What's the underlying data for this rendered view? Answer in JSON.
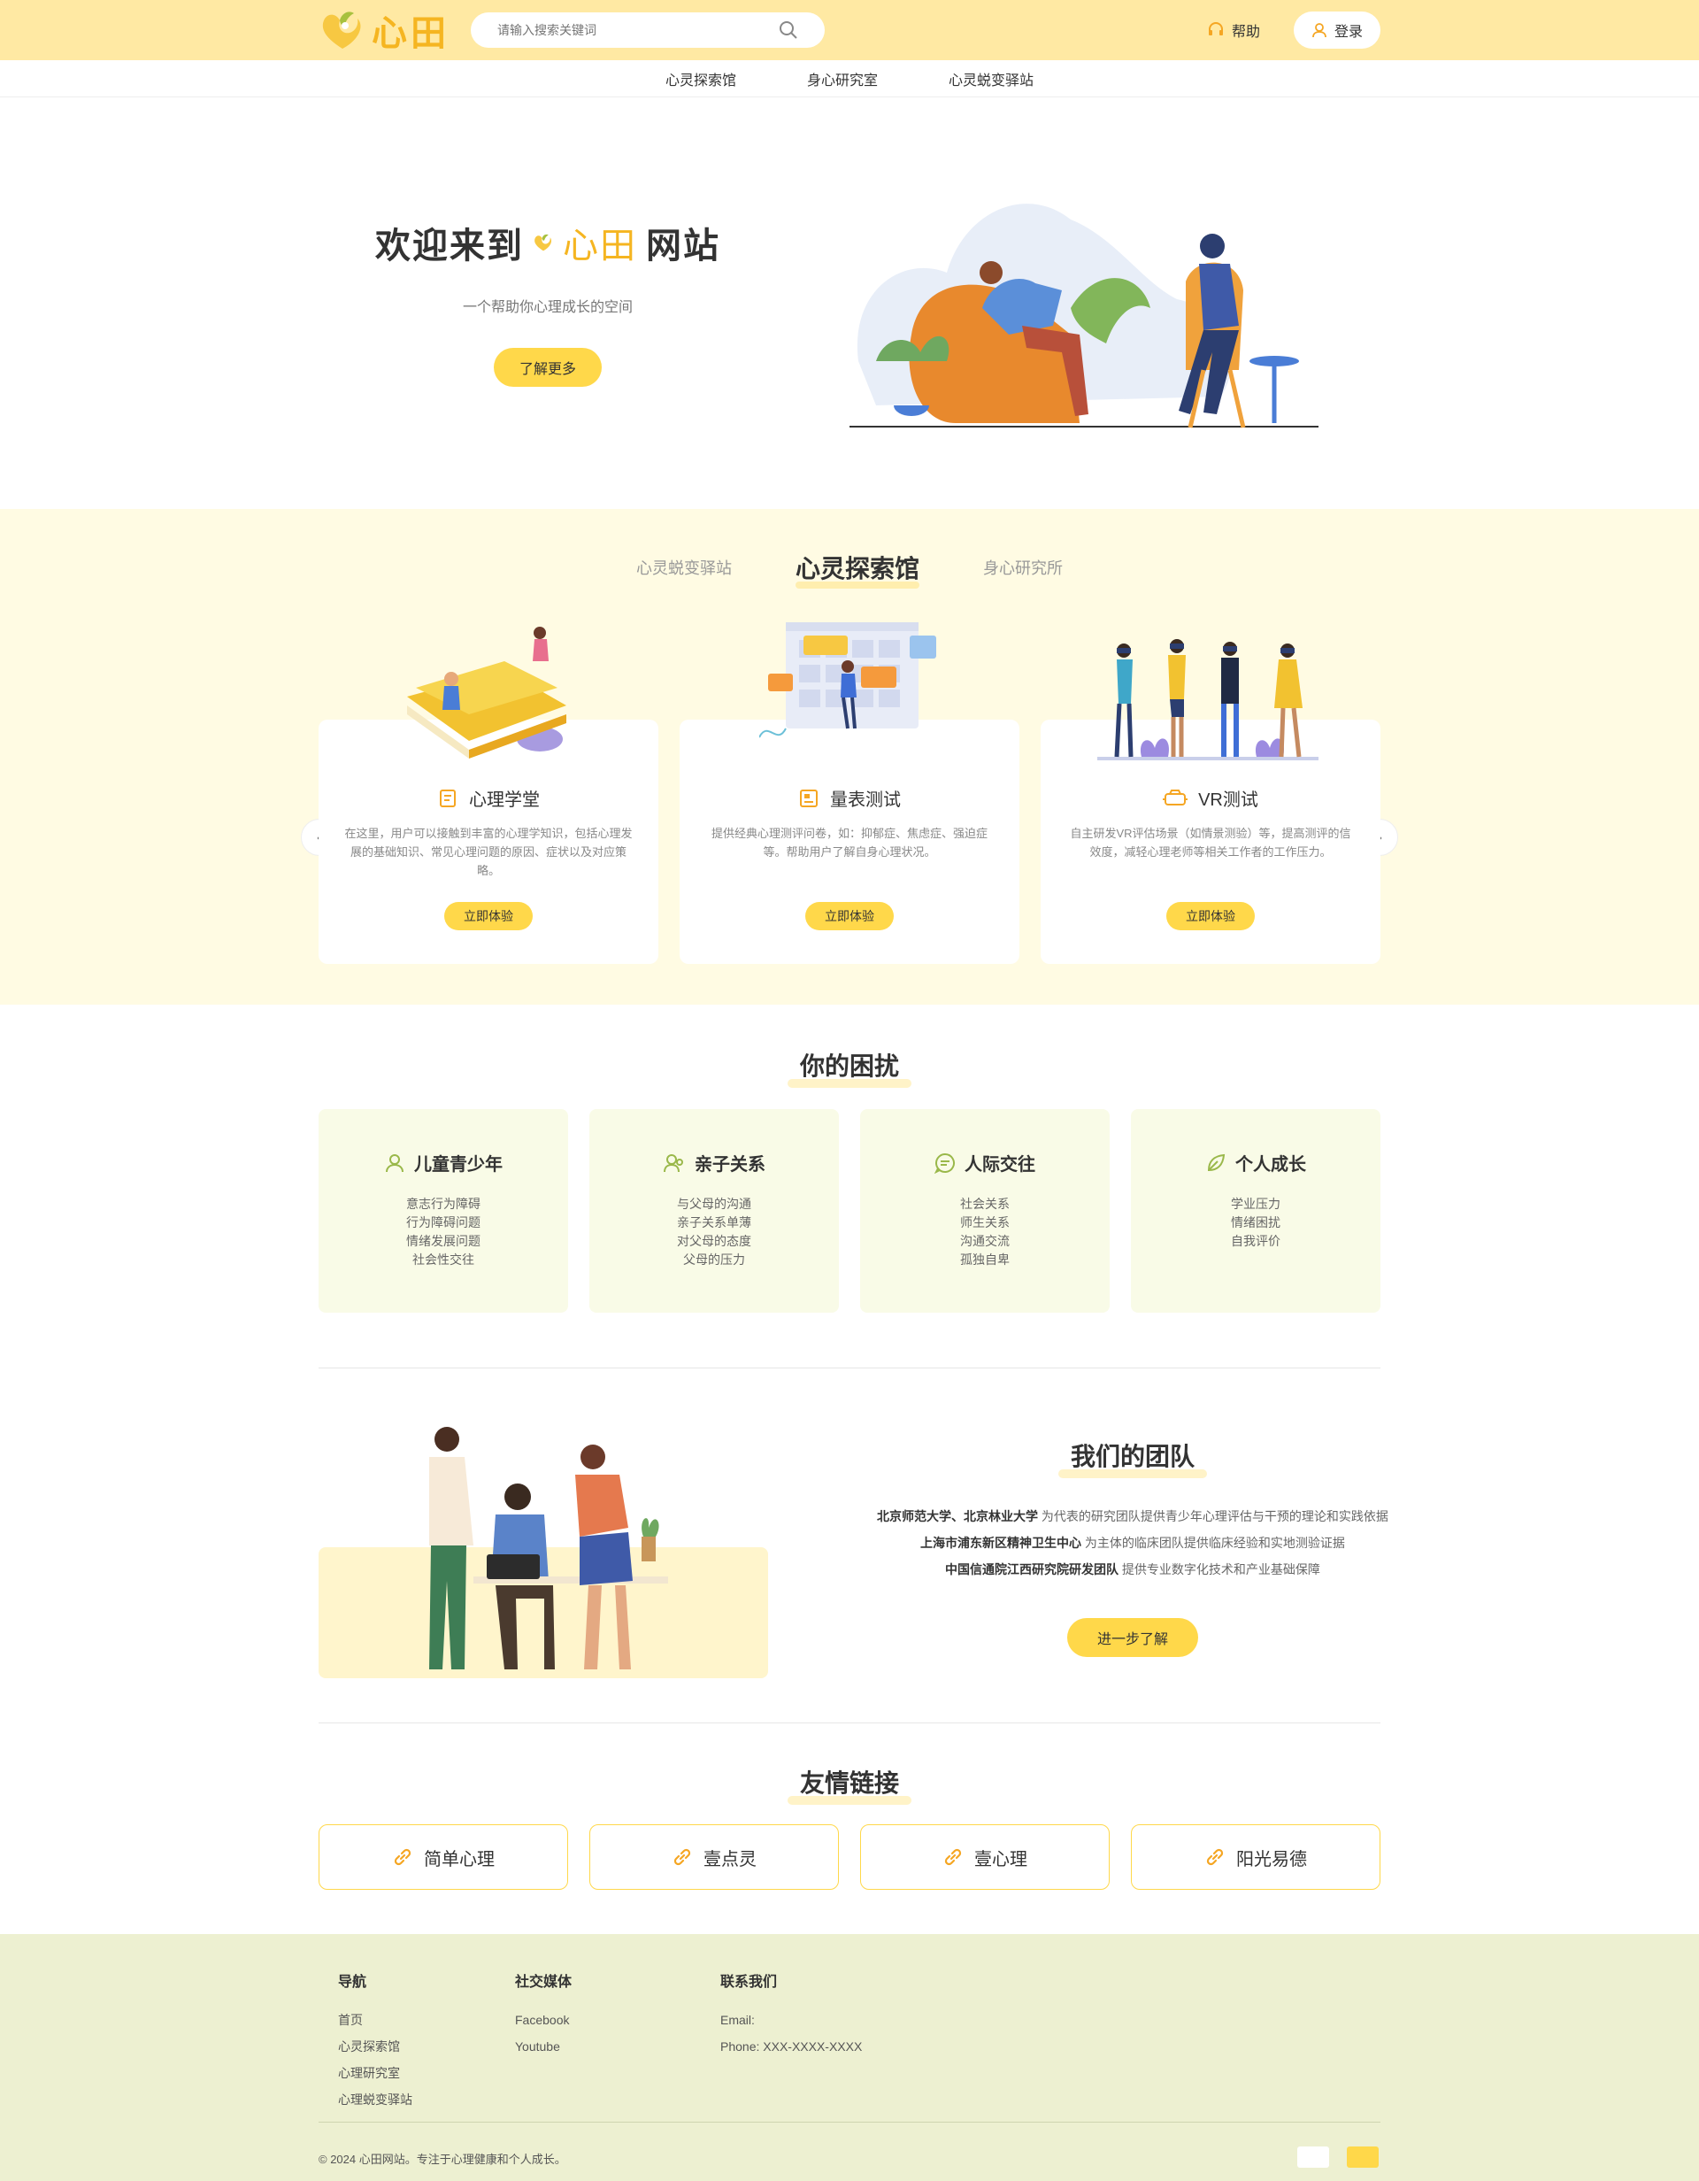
{
  "header": {
    "logo_text": "心田",
    "search_placeholder": "请输入搜索关键词",
    "help_label": "帮助",
    "login_label": "登录"
  },
  "nav": [
    "心灵探索馆",
    "身心研究室",
    "心灵蜕变驿站"
  ],
  "hero": {
    "title_before": "欢迎来到",
    "title_brand": "心田",
    "title_after": "网站",
    "subtitle": "一个帮助你心理成长的空间",
    "button": "了解更多"
  },
  "explore": {
    "tabs": [
      "心灵蜕变驿站",
      "心灵探索馆",
      "身心研究所"
    ],
    "active_tab": 1,
    "cards": [
      {
        "title": "心理学堂",
        "icon": "book-icon",
        "desc": "在这里，用户可以接触到丰富的心理学知识，包括心理发展的基础知识、常见心理问题的原因、症状以及对应策略。",
        "button": "立即体验"
      },
      {
        "title": "量表测试",
        "icon": "clipboard-icon",
        "desc": "提供经典心理测评问卷，如：抑郁症、焦虑症、强迫症等。帮助用户了解自身心理状况。",
        "button": "立即体验"
      },
      {
        "title": "VR测试",
        "icon": "vr-headset-icon",
        "desc": "自主研发VR评估场景（如情景测验）等，提高测评的信效度，减轻心理老师等相关工作者的工作压力。",
        "button": "立即体验"
      }
    ]
  },
  "troubles": {
    "title": "你的困扰",
    "items": [
      {
        "title": "儿童青少年",
        "icon": "person-icon",
        "lines": [
          "意志行为障碍",
          "行为障碍问题",
          "情绪发展问题",
          "社会性交往"
        ]
      },
      {
        "title": "亲子关系",
        "icon": "family-icon",
        "lines": [
          "与父母的沟通",
          "亲子关系单薄",
          "对父母的态度",
          "父母的压力"
        ]
      },
      {
        "title": "人际交往",
        "icon": "chat-icon",
        "lines": [
          "社会关系",
          "师生关系",
          "沟通交流",
          "孤独自卑"
        ]
      },
      {
        "title": "个人成长",
        "icon": "leaf-icon",
        "lines": [
          "学业压力",
          "情绪困扰",
          "自我评价"
        ]
      }
    ]
  },
  "team": {
    "title": "我们的团队",
    "lines": [
      {
        "bold": "北京师范大学、北京林业大学",
        "text": " 为代表的研究团队提供青少年心理评估与干预的理论和实践依据"
      },
      {
        "bold": "上海市浦东新区精神卫生中心",
        "text": " 为主体的临床团队提供临床经验和实地测验证据"
      },
      {
        "bold": "中国信通院江西研究院研发团队",
        "text": " 提供专业数字化技术和产业基础保障"
      }
    ],
    "button": "进一步了解"
  },
  "links": {
    "title": "友情链接",
    "items": [
      "简单心理",
      "壹点灵",
      "壹心理",
      "阳光易德"
    ]
  },
  "footer": {
    "nav_title": "导航",
    "nav_items": [
      "首页",
      "心灵探索馆",
      "心理研究室",
      "心理蜕变驿站"
    ],
    "social_title": "社交媒体",
    "social_items": [
      "Facebook",
      "Youtube"
    ],
    "contact_title": "联系我们",
    "contact_items": [
      "Email:",
      "Phone: XXX-XXXX-XXXX"
    ],
    "copyright": "© 2024 心田网站。专注于心理健康和个人成长。"
  },
  "colors": {
    "accent": "#FFD84A",
    "brand": "#F5B521",
    "header_bg": "#FFE9A3",
    "section_bg": "#FFFBE3",
    "footer_bg": "#EDF0D1"
  }
}
